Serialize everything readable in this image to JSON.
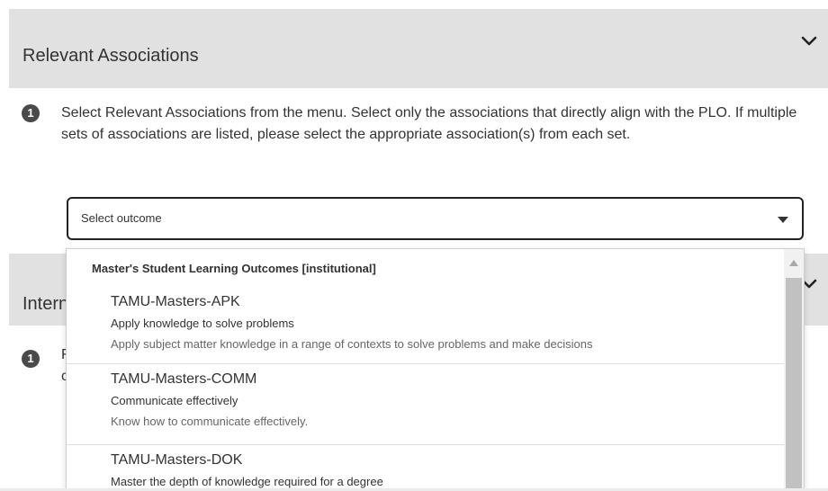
{
  "sections": [
    {
      "title": "Relevant Associations",
      "icon": "chevron-down-icon"
    },
    {
      "title": "Intern",
      "icon": "chevron-down-icon"
    }
  ],
  "step_number": "1",
  "instructions": "Select Relevant Associations from the menu. Select only the associations that directly align with the PLO. If multiple sets of associations are listed, please select the appropriate association(s) from each set.",
  "second_section_text": [
    "F",
    "c"
  ],
  "select": {
    "value": "Select outcome",
    "caret_icon": "caret-down-icon"
  },
  "dropdown": {
    "group_label": "Master's Student Learning Outcomes [institutional]",
    "options": [
      {
        "code": "TAMU-Masters-APK",
        "name": "Apply knowledge to solve problems",
        "description": "Apply subject matter knowledge in a range of contexts to solve problems and make decisions"
      },
      {
        "code": "TAMU-Masters-COMM",
        "name": "Communicate effectively",
        "description": "Know how to communicate effectively."
      },
      {
        "code": "TAMU-Masters-DOK",
        "name": "Master the depth of knowledge required for a degree",
        "description": ""
      }
    ]
  },
  "colors": {
    "header_bg": "#e1e1e1",
    "badge_bg": "#4a4a4a",
    "text": "#333333",
    "muted_text": "#666666",
    "scroll_thumb": "#c1c1c1"
  }
}
